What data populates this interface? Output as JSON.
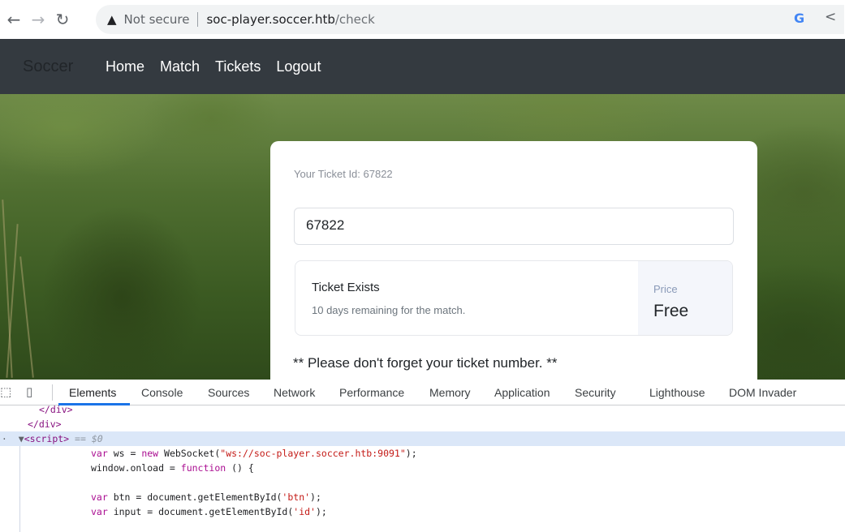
{
  "browser": {
    "security_label": "Not secure",
    "url_host": "soc-player.soccer.htb",
    "url_path": "/check"
  },
  "site": {
    "brand": "Soccer",
    "nav": [
      "Home",
      "Match",
      "Tickets",
      "Logout"
    ]
  },
  "ticket_card": {
    "label": "Your Ticket Id: 67822",
    "input_value": "67822",
    "status_title": "Ticket Exists",
    "status_sub": "10 days remaining for the match.",
    "price_label": "Price",
    "price_value": "Free",
    "reminder": "** Please don't forget your ticket number. **"
  },
  "devtools": {
    "tabs": [
      "Elements",
      "Console",
      "Sources",
      "Network",
      "Performance",
      "Memory",
      "Application",
      "Security",
      "Lighthouse",
      "DOM Invader"
    ],
    "active_tab": "Elements",
    "code": {
      "l0": "</div>",
      "l1": "</div>",
      "l2_tag": "<script>",
      "l2_marker": "== $0",
      "l3_a": "var",
      "l3_b": " ws = ",
      "l3_c": "new",
      "l3_d": " WebSocket(",
      "l3_e": "\"ws://soc-player.soccer.htb:9091\"",
      "l3_f": ");",
      "l4_a": "window.onload = ",
      "l4_b": "function",
      "l4_c": " () {",
      "l6_a": "var",
      "l6_b": " btn = document.getElementById(",
      "l6_c": "'btn'",
      "l6_d": ");",
      "l7_a": "var",
      "l7_b": " input = document.getElementById(",
      "l7_c": "'id'",
      "l7_d": ");"
    }
  },
  "icons": {
    "back": "back-arrow-icon",
    "forward": "forward-arrow-icon",
    "reload": "reload-icon",
    "warning": "warning-icon",
    "google": "google-icon",
    "share": "share-icon",
    "inspect": "inspect-element-icon",
    "device": "device-toolbar-icon"
  }
}
